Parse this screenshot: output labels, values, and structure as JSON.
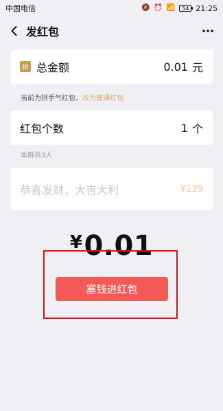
{
  "status_bar": {
    "carrier": "中国电信",
    "battery": "54",
    "time": "21:25",
    "icons": [
      "mute-icon",
      "alarm-icon",
      "wifi-icon",
      "signal-icon",
      "battery-icon"
    ]
  },
  "nav": {
    "title": "发红包",
    "back_icon": "chevron-left-icon",
    "more_icon": "more-horizontal-icon"
  },
  "amount": {
    "badge": "拼",
    "label": "总金额",
    "value": "0.01",
    "unit": "元"
  },
  "hint": {
    "text": "当前为拼手气红包，",
    "link": "改为普通红包"
  },
  "count": {
    "label": "红包个数",
    "value": "1",
    "unit": "个"
  },
  "group_size_text": "本群共3人",
  "message": {
    "placeholder": "恭喜发财，大吉大利",
    "emoji_price": "¥139"
  },
  "total_display": {
    "currency": "¥",
    "amount": "0.01"
  },
  "submit": {
    "label": "塞钱进红包"
  },
  "colors": {
    "background": "#efeff4",
    "submit": "#f35a57",
    "hint_link": "#d9a75e",
    "badge": "#c89e4d",
    "highlight_box": "#dd1111"
  }
}
